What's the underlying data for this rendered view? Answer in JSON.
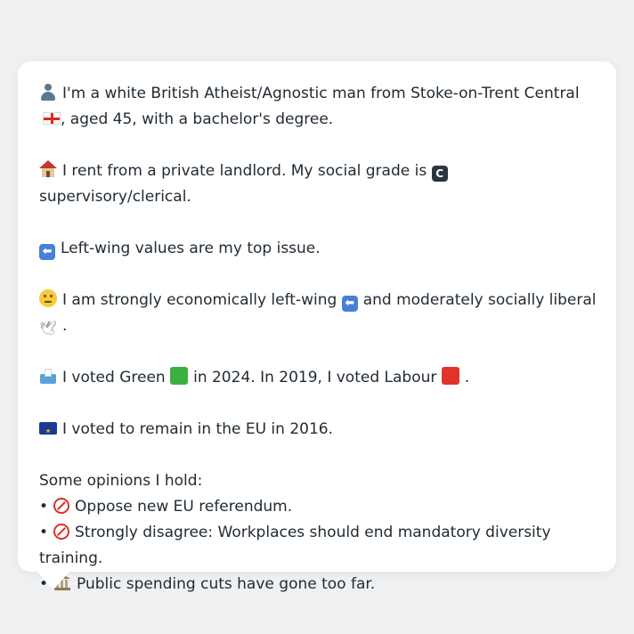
{
  "profile": {
    "identity_text": "I'm a white British Atheist/Agnostic man from Stoke-on-Trent Central",
    "identity_tail": ", aged 45, with a bachelor's degree.",
    "housing_text": "I rent from a private landlord. My social grade is",
    "grade_letter": "C",
    "grade_desc": "supervisory/clerical.",
    "top_issue": "Left-wing values are my top issue.",
    "ideology_a": "I am strongly economically left-wing",
    "ideology_b": "and moderately socially liberal",
    "ideology_end": ".",
    "vote_a": "I voted Green",
    "vote_b": "in 2024. In 2019, I voted Labour",
    "vote_end": ".",
    "eu_vote": "I voted to remain in the EU in 2016.",
    "opinions_heading": "Some opinions I hold:",
    "opinions": [
      {
        "bullet": "•",
        "text": "Oppose new EU referendum."
      },
      {
        "bullet": "•",
        "text": "Strongly disagree: Workplaces should end mandatory diversity training."
      },
      {
        "bullet": "•",
        "text": "Public spending cuts have gone too far."
      }
    ]
  },
  "icons": {
    "person": "person-silhouette-icon",
    "england_flag": "england-flag-icon",
    "house": "house-icon",
    "grade_badge": "letter-c-badge-icon",
    "left_arrow": "left-arrow-icon",
    "thinking": "thinking-face-icon",
    "dove": "dove-icon",
    "ballot": "ballot-box-icon",
    "green_square": "green-square-icon",
    "red_square": "red-square-icon",
    "eu_flag": "eu-flag-icon",
    "no_entry": "no-entry-icon",
    "building": "classical-building-icon"
  },
  "colors": {
    "background": "#eff0f2",
    "card": "#ffffff",
    "text": "#1f2a33",
    "green": "#3cb043",
    "red": "#e0342b",
    "arrow_badge": "#4a7fd6"
  }
}
